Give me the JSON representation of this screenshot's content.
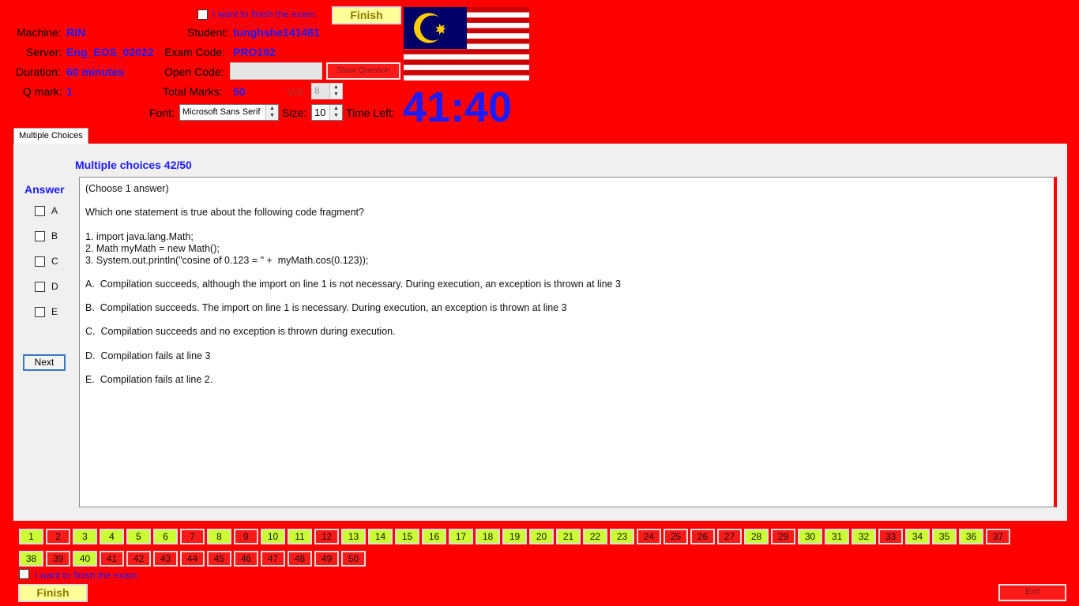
{
  "header": {
    "finish_checkbox_label": "I want to finish the exam.",
    "finish_button": "Finish",
    "machine_label": "Machine:",
    "machine_value": "RIN",
    "student_label": "Student:",
    "student_value": "tunghshe141481",
    "server_label": "Server:",
    "server_value": "Eng_EOS_02022",
    "exam_code_label": "Exam Code:",
    "exam_code_value": "PRO192",
    "duration_label": "Duration:",
    "duration_value": "60 minutes",
    "open_code_label": "Open Code:",
    "open_code_value": "",
    "show_question_button": "Show Question",
    "q_mark_label": "Q mark:",
    "q_mark_value": "1",
    "total_marks_label": "Total Marks:",
    "total_marks_value": "50",
    "vol_label": "Vol:",
    "vol_value": "8",
    "font_label": "Font:",
    "font_value": "Microsoft Sans Serif",
    "size_label": "Size:",
    "size_value": "10",
    "time_left_label": "Time Left:",
    "timer": "41:40"
  },
  "tab": {
    "label": "Multiple Choices"
  },
  "question": {
    "heading": "Multiple choices 42/50",
    "answer_heading": "Answer",
    "options": [
      "A",
      "B",
      "C",
      "D",
      "E"
    ],
    "next_button": "Next",
    "lines": [
      "(Choose 1 answer)",
      "Which one statement is true about the following code fragment?",
      "1. import java.lang.Math;",
      "2. Math myMath = new Math();",
      "3. System.out.println(\"cosine of 0.123 = \" +  myMath.cos(0.123));",
      "A.  Compilation succeeds, although the import on line 1 is not necessary. During execution, an exception is thrown at line 3",
      "B.  Compilation succeeds. The import on line 1 is necessary. During execution, an exception is thrown at line 3",
      "C.  Compilation succeeds and no exception is thrown during execution.",
      "D.  Compilation fails at line 3",
      "E.  Compilation fails at line 2."
    ]
  },
  "question_numbers": [
    {
      "n": "1",
      "s": "g"
    },
    {
      "n": "2",
      "s": "r"
    },
    {
      "n": "3",
      "s": "g"
    },
    {
      "n": "4",
      "s": "g"
    },
    {
      "n": "5",
      "s": "g"
    },
    {
      "n": "6",
      "s": "g"
    },
    {
      "n": "7",
      "s": "r"
    },
    {
      "n": "8",
      "s": "g"
    },
    {
      "n": "9",
      "s": "r"
    },
    {
      "n": "10",
      "s": "g"
    },
    {
      "n": "11",
      "s": "g"
    },
    {
      "n": "12",
      "s": "r"
    },
    {
      "n": "13",
      "s": "g"
    },
    {
      "n": "14",
      "s": "g"
    },
    {
      "n": "15",
      "s": "g"
    },
    {
      "n": "16",
      "s": "g"
    },
    {
      "n": "17",
      "s": "g"
    },
    {
      "n": "18",
      "s": "g"
    },
    {
      "n": "19",
      "s": "g"
    },
    {
      "n": "20",
      "s": "g"
    },
    {
      "n": "21",
      "s": "g"
    },
    {
      "n": "22",
      "s": "g"
    },
    {
      "n": "23",
      "s": "g"
    },
    {
      "n": "24",
      "s": "r"
    },
    {
      "n": "25",
      "s": "r"
    },
    {
      "n": "26",
      "s": "r"
    },
    {
      "n": "27",
      "s": "r"
    },
    {
      "n": "28",
      "s": "g"
    },
    {
      "n": "29",
      "s": "r"
    },
    {
      "n": "30",
      "s": "g"
    },
    {
      "n": "31",
      "s": "g"
    },
    {
      "n": "32",
      "s": "g"
    },
    {
      "n": "33",
      "s": "r"
    },
    {
      "n": "34",
      "s": "g"
    },
    {
      "n": "35",
      "s": "g"
    },
    {
      "n": "36",
      "s": "g"
    },
    {
      "n": "37",
      "s": "r"
    },
    {
      "n": "38",
      "s": "g"
    },
    {
      "n": "39",
      "s": "r"
    },
    {
      "n": "40",
      "s": "g"
    },
    {
      "n": "41",
      "s": "r"
    },
    {
      "n": "42",
      "s": "r"
    },
    {
      "n": "43",
      "s": "r"
    },
    {
      "n": "44",
      "s": "r"
    },
    {
      "n": "45",
      "s": "r"
    },
    {
      "n": "46",
      "s": "r"
    },
    {
      "n": "47",
      "s": "r"
    },
    {
      "n": "48",
      "s": "r"
    },
    {
      "n": "49",
      "s": "r"
    },
    {
      "n": "50",
      "s": "r"
    }
  ],
  "footer": {
    "finish_checkbox_label": "I want to finish the exam.",
    "finish_button": "Finish",
    "exit_button": "Exit"
  },
  "colors": {
    "background": "#ff0000",
    "answered": "#ccff33",
    "unanswered": "#ff1a1a",
    "accent": "#1b1bff"
  },
  "icons": {
    "flag": "malaysia-flag-icon"
  }
}
